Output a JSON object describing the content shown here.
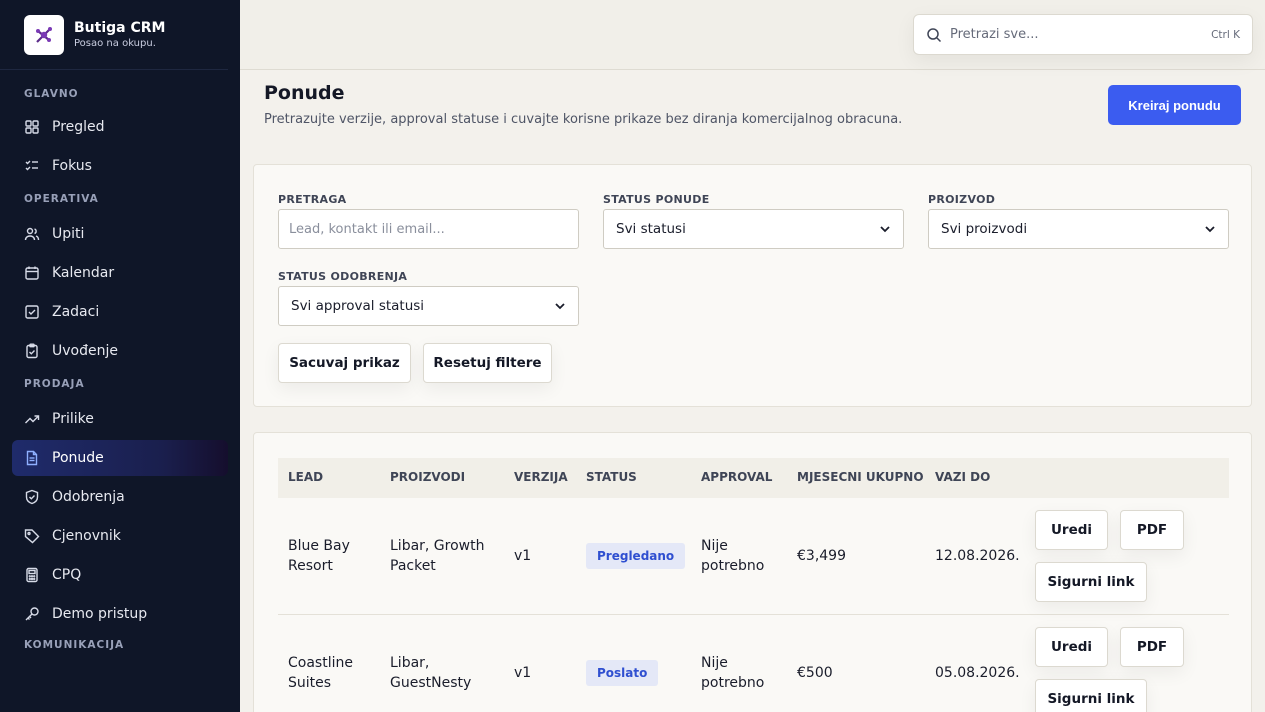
{
  "brand": {
    "name": "Butiga CRM",
    "tagline": "Posao na okupu."
  },
  "sidebar": {
    "sections": [
      {
        "label": "GLAVNO",
        "items": [
          {
            "label": "Pregled",
            "icon": "grid-icon"
          },
          {
            "label": "Fokus",
            "icon": "list-check-icon"
          }
        ]
      },
      {
        "label": "OPERATIVA",
        "items": [
          {
            "label": "Upiti",
            "icon": "users-icon"
          },
          {
            "label": "Kalendar",
            "icon": "calendar-icon"
          },
          {
            "label": "Zadaci",
            "icon": "checkbox-icon"
          },
          {
            "label": "Uvođenje",
            "icon": "clipboard-icon"
          }
        ]
      },
      {
        "label": "PRODAJA",
        "items": [
          {
            "label": "Prilike",
            "icon": "trend-icon"
          },
          {
            "label": "Ponude",
            "icon": "document-icon",
            "active": true
          },
          {
            "label": "Odobrenja",
            "icon": "shield-icon"
          },
          {
            "label": "Cjenovnik",
            "icon": "tag-icon"
          },
          {
            "label": "CPQ",
            "icon": "calculator-icon"
          },
          {
            "label": "Demo pristup",
            "icon": "key-icon"
          }
        ]
      },
      {
        "label": "KOMUNIKACIJA",
        "items": []
      }
    ]
  },
  "search": {
    "placeholder": "Pretrazi sve...",
    "shortcut": "Ctrl K"
  },
  "page": {
    "title": "Ponude",
    "subtitle": "Pretrazujte verzije, approval statuse i cuvajte korisne prikaze bez diranja komercijalnog obracuna.",
    "create_label": "Kreiraj ponudu"
  },
  "filters": {
    "search_label": "PRETRAGA",
    "search_placeholder": "Lead, kontakt ili email...",
    "status_label": "STATUS PONUDE",
    "status_value": "Svi statusi",
    "product_label": "PROIZVOD",
    "product_value": "Svi proizvodi",
    "approval_label": "STATUS ODOBRENJA",
    "approval_value": "Svi approval statusi",
    "save_label": "Sacuvaj prikaz",
    "reset_label": "Resetuj filtere"
  },
  "table": {
    "headers": {
      "lead": "LEAD",
      "products": "PROIZVODI",
      "version": "VERZIJA",
      "status": "STATUS",
      "approval": "APPROVAL",
      "monthly": "MJESECNI UKUPNO",
      "valid": "VAZI DO"
    },
    "actions": {
      "edit": "Uredi",
      "pdf": "PDF",
      "link": "Sigurni link"
    },
    "rows": [
      {
        "lead1": "Blue Bay",
        "lead2": "Resort",
        "prod1": "Libar, Growth",
        "prod2": "Packet",
        "version": "v1",
        "status": "Pregledano",
        "appr1": "Nije",
        "appr2": "potrebno",
        "monthly": "€3,499",
        "valid": "12.08.2026."
      },
      {
        "lead1": "Coastline",
        "lead2": "Suites",
        "prod1": "Libar,",
        "prod2": "GuestNesty",
        "version": "v1",
        "status": "Poslato",
        "appr1": "Nije",
        "appr2": "potrebno",
        "monthly": "€500",
        "valid": "05.08.2026."
      }
    ]
  }
}
